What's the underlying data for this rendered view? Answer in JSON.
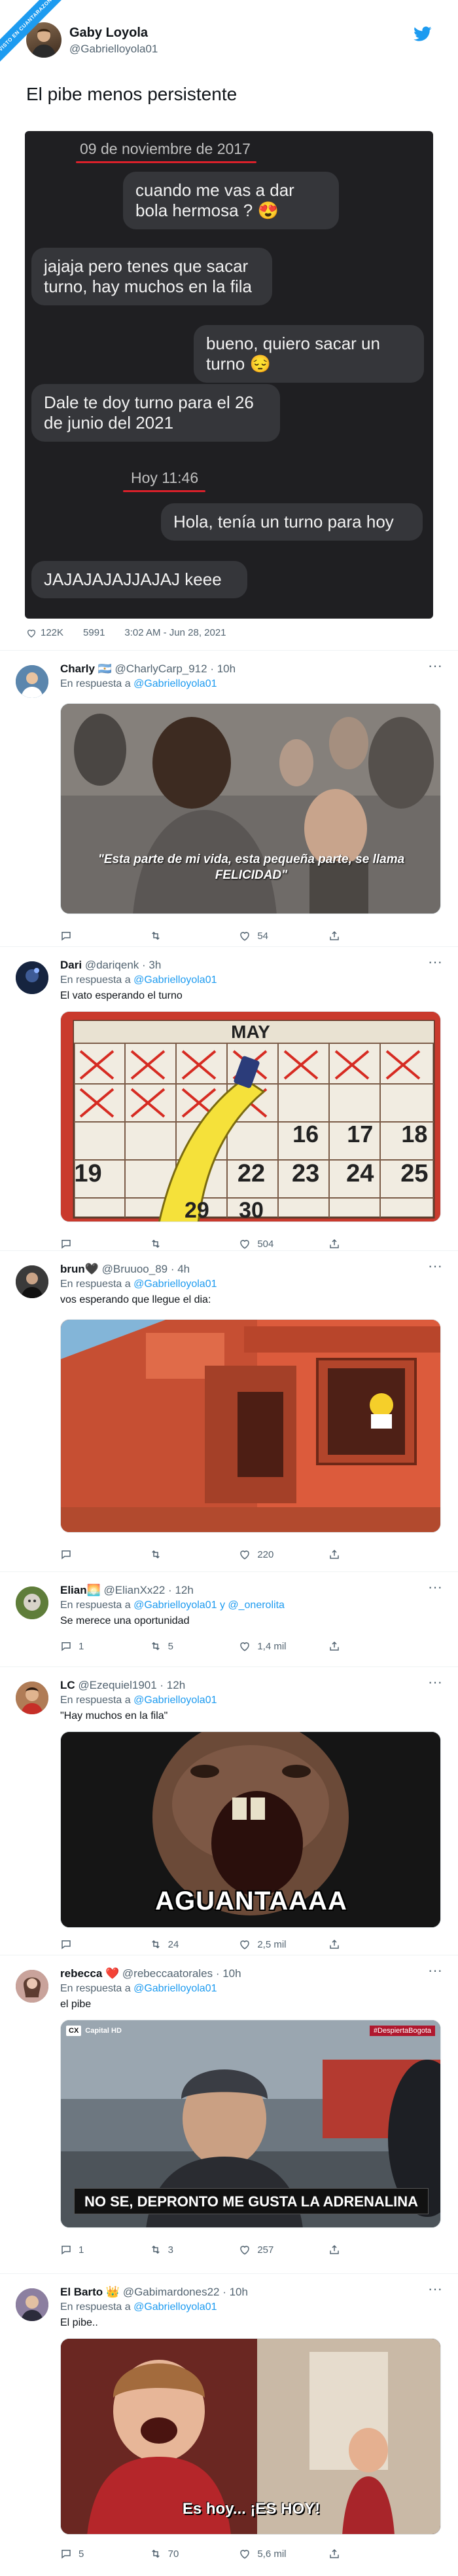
{
  "ribbon": "VISTO EN CUANTARAZON",
  "tweet": {
    "name": "Gaby Loyola",
    "handle": "@Gabrielloyola01",
    "text": "El pibe menos persistente",
    "stats": {
      "likes": "122K",
      "retweets": "5991",
      "time": "3:02 AM - Jun 28, 2021"
    }
  },
  "chat": {
    "date1": "09 de noviembre de 2017",
    "msg1": "cuando me vas a dar bola hermosa ? 😍",
    "msg2": "jajaja pero tenes que sacar turno, hay muchos en la fila",
    "msg3": "bueno, quiero sacar un turno 😔",
    "msg4": "Dale te doy turno para el 26 de junio del 2021",
    "date2": "Hoy 11:46",
    "msg5": "Hola, tenía un turno para hoy",
    "msg6": "JAJAJAJAJJAJAJ keee"
  },
  "replies": [
    {
      "name": "Charly 🇦🇷",
      "handle": "@CharlyCarp_912 · 10h",
      "to_prefix": "En respuesta a",
      "to": "@Gabrielloyola01",
      "to2": "",
      "text": "",
      "caption": "\"Esta parte de mi vida, esta pequeña parte, se llama FELICIDAD\"",
      "actions": [
        "",
        "",
        "54",
        ""
      ]
    },
    {
      "name": "Dari",
      "handle": "@dariqenk · 3h",
      "to_prefix": "En respuesta a",
      "to": "@Gabrielloyola01",
      "to2": "",
      "text": "El vato esperando el turno",
      "caption": "MAY",
      "actions": [
        "",
        "",
        "504",
        ""
      ]
    },
    {
      "name": "brun🖤",
      "handle": "@Bruuoo_89 · 4h",
      "to_prefix": "En respuesta a",
      "to": "@Gabrielloyola01",
      "to2": "",
      "text": "vos esperando que llegue el dia:",
      "caption": "",
      "actions": [
        "",
        "",
        "220",
        ""
      ]
    },
    {
      "name": "Elian🌅",
      "handle": "@ElianXx22 · 12h",
      "to_prefix": "En respuesta a",
      "to": "@Gabrielloyola01 y @_onerolita",
      "to2": "",
      "text": "Se merece una oportunidad",
      "caption": "",
      "actions": [
        "1",
        "5",
        "1,4 mil",
        ""
      ]
    },
    {
      "name": "LC",
      "handle": "@Ezequiel1901 · 12h",
      "to_prefix": "En respuesta a",
      "to": "@Gabrielloyola01",
      "to2": "",
      "text": "\"Hay muchos en la fila\"",
      "caption": "AGUANTAAAA",
      "actions": [
        "",
        "24",
        "2,5 mil",
        ""
      ]
    },
    {
      "name": "rebecca ❤️",
      "handle": "@rebeccaatorales · 10h",
      "to_prefix": "En respuesta a",
      "to": "@Gabrielloyola01",
      "to2": "",
      "text": "el pibe",
      "caption": "NO SE, DEPRONTO ME GUSTA LA ADRENALINA",
      "actions": [
        "1",
        "3",
        "257",
        ""
      ]
    },
    {
      "name": "El Barto 👑",
      "handle": "@Gabimardones22 · 10h",
      "to_prefix": "En respuesta a",
      "to": "@Gabrielloyola01",
      "to2": "",
      "text": "El pibe..",
      "caption": "Es hoy... ¡ES HOY!",
      "actions": [
        "5",
        "70",
        "5,6 mil",
        ""
      ]
    }
  ],
  "calendar": {
    "row1": [
      "",
      "",
      "",
      "",
      "",
      "",
      ""
    ],
    "row2": [
      "",
      "",
      "",
      "",
      "16",
      "17",
      "18"
    ],
    "row3": [
      "19",
      "",
      "",
      "22",
      "23",
      "24",
      "25"
    ],
    "row4": [
      "",
      "",
      "29",
      "30",
      "",
      "",
      ""
    ]
  },
  "badge": "#DespiertaBogota",
  "channel": "Capital HD"
}
